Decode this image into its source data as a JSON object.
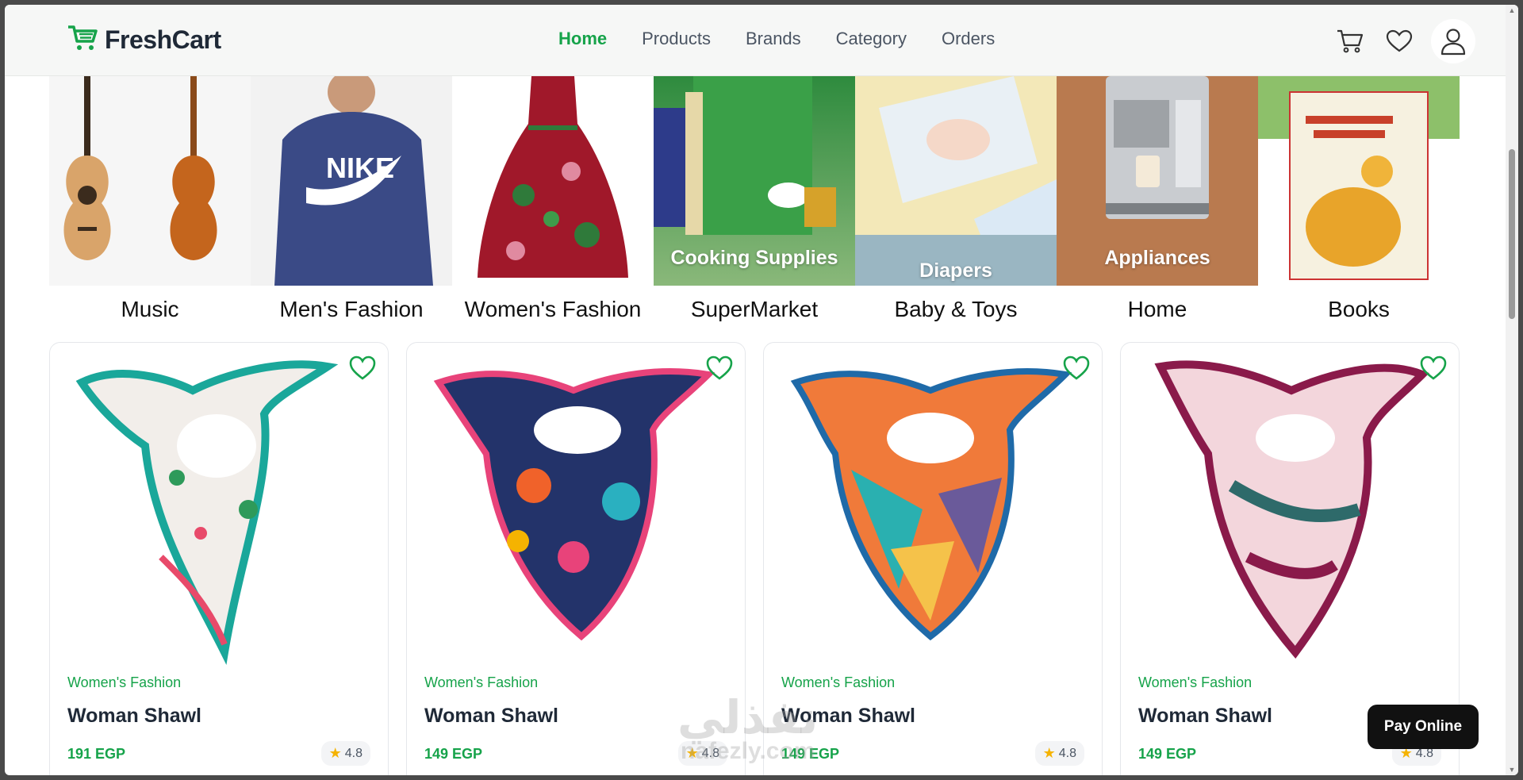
{
  "brand": {
    "name": "FreshCart",
    "accent_color": "#16a34a"
  },
  "nav": {
    "links": [
      {
        "label": "Home",
        "active": true
      },
      {
        "label": "Products",
        "active": false
      },
      {
        "label": "Brands",
        "active": false
      },
      {
        "label": "Category",
        "active": false
      },
      {
        "label": "Orders",
        "active": false
      }
    ],
    "icons": [
      "cart-icon",
      "heart-icon",
      "user-icon"
    ]
  },
  "categories": [
    {
      "name": "Music",
      "overlay": ""
    },
    {
      "name": "Men's Fashion",
      "overlay": ""
    },
    {
      "name": "Women's Fashion",
      "overlay": ""
    },
    {
      "name": "SuperMarket",
      "overlay": "Cooking Supplies"
    },
    {
      "name": "Baby & Toys",
      "overlay": "Diapers"
    },
    {
      "name": "Home",
      "overlay": "Appliances"
    },
    {
      "name": "Books",
      "overlay": ""
    }
  ],
  "products": [
    {
      "category": "Women's Fashion",
      "title": "Woman Shawl",
      "price": "191 EGP",
      "rating": "4.8"
    },
    {
      "category": "Women's Fashion",
      "title": "Woman Shawl",
      "price": "149 EGP",
      "rating": "4.8"
    },
    {
      "category": "Women's Fashion",
      "title": "Woman Shawl",
      "price": "149 EGP",
      "rating": "4.8"
    },
    {
      "category": "Women's Fashion",
      "title": "Woman Shawl",
      "price": "149 EGP",
      "rating": "4.8"
    }
  ],
  "floating": {
    "pay_label": "Pay Online"
  },
  "watermark": {
    "arabic": "نفذلي",
    "latin": "nafezly.com"
  }
}
